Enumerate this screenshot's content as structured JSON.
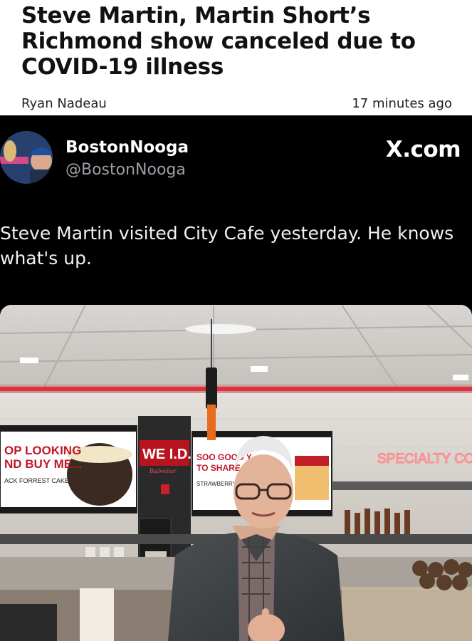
{
  "article": {
    "headline": "Steve Martin, Martin Short’s Richmond show canceled due to COVID-19 illness",
    "author": "Ryan Nadeau",
    "timestamp": "17 minutes ago"
  },
  "tweet": {
    "display_name": "BostonNooga",
    "handle": "@BostonNooga",
    "site": "X.com",
    "text": "Steve Martin visited City Cafe yesterday. He knows what's up.",
    "photo": {
      "signs": {
        "left_banner_line1": "OP LOOKING",
        "left_banner_line2": "ND BUY ME...",
        "left_banner_caption": "ACK FORREST CAKE",
        "center_sign": "WE I.D.",
        "center_sign_sub": "Budweiser",
        "right_banner_line1": "SOO GOOD Y",
        "right_banner_line2": "TO SHARE...",
        "right_banner_caption": "STRAWBERRY",
        "neon_sign": "SPECIALTY CO"
      }
    }
  },
  "colors": {
    "tweet_background": "#000000",
    "handle_gray": "#9aa0a6",
    "neon_red": "#e0303a"
  },
  "icons": [
    "avatar",
    "x-logo"
  ]
}
